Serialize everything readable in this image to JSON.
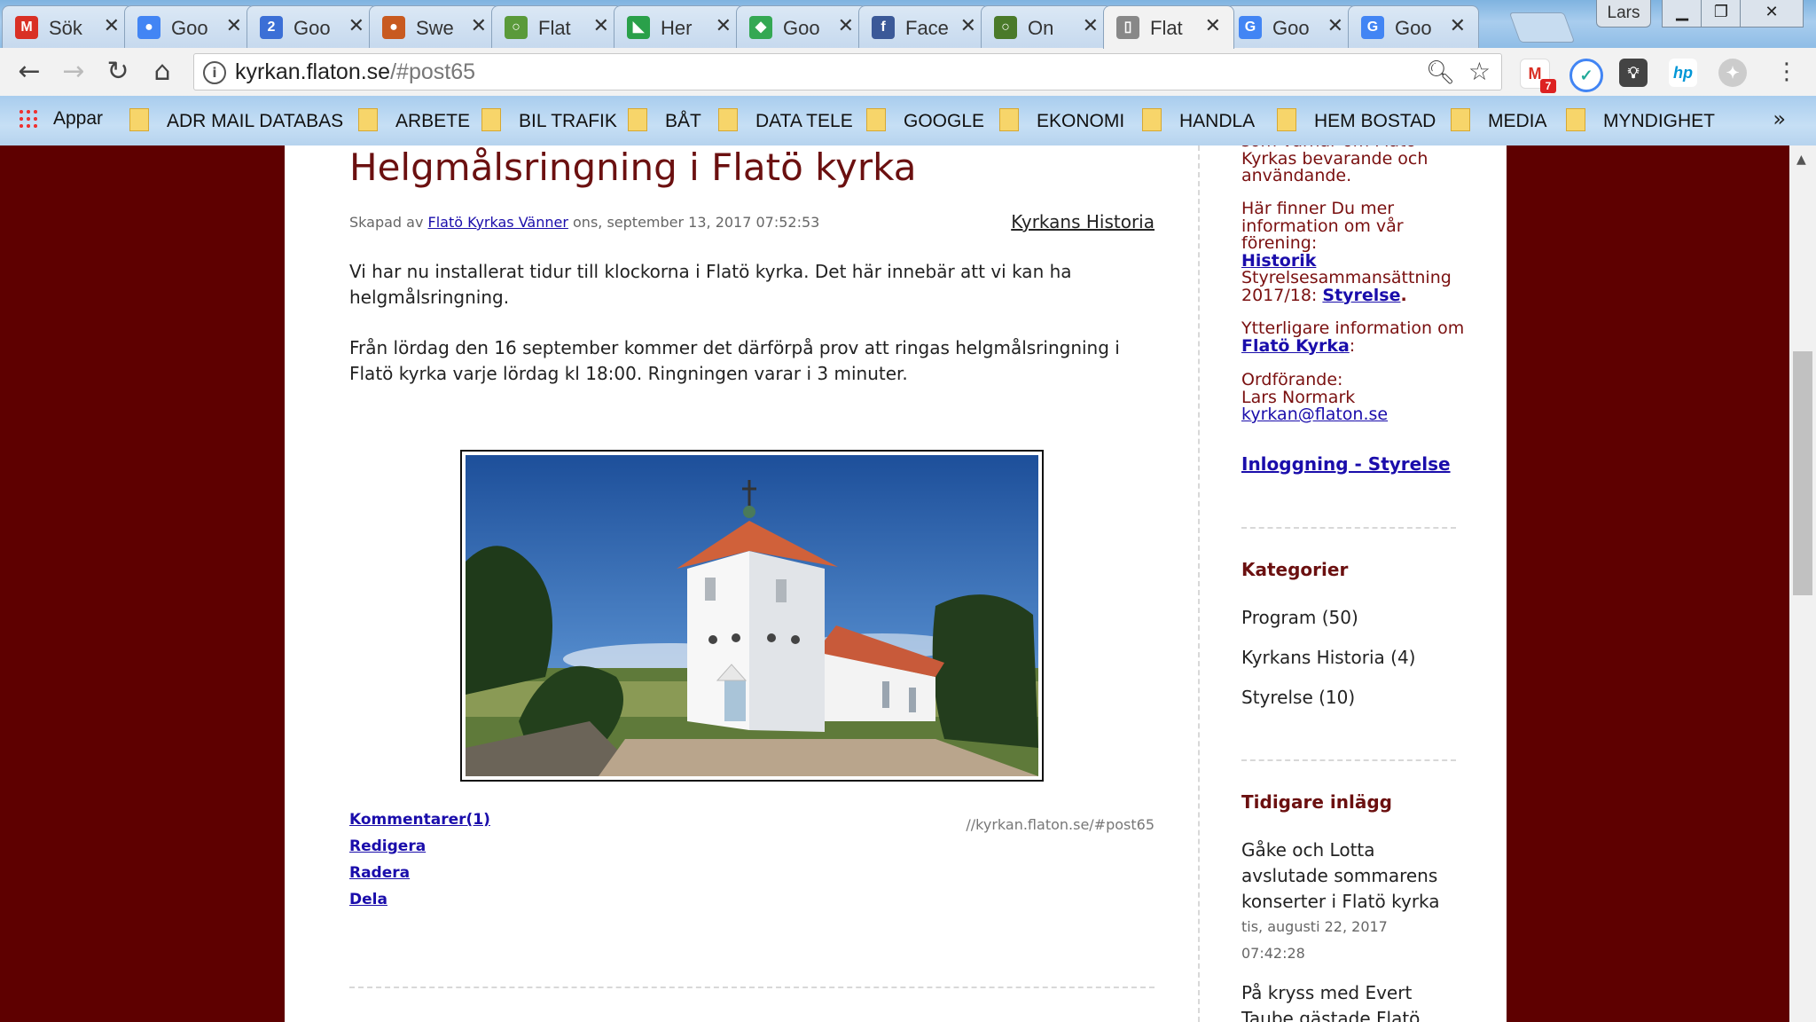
{
  "browser": {
    "tabs": [
      {
        "title": "Sök",
        "icon": "gmail-icon",
        "color": "#d93025",
        "glyph": "M"
      },
      {
        "title": "Goo",
        "icon": "google-contacts-icon",
        "color": "#4285f4",
        "glyph": "●"
      },
      {
        "title": "Goo",
        "icon": "google-calendar-icon",
        "color": "#3b6fd6",
        "glyph": "2"
      },
      {
        "title": "Swe",
        "icon": "swe-icon",
        "color": "#c85a20",
        "glyph": "●"
      },
      {
        "title": "Flat",
        "icon": "flaton-ring-icon",
        "color": "#5a9a3a",
        "glyph": "○"
      },
      {
        "title": "Her",
        "icon": "here-icon",
        "color": "#2aa04a",
        "glyph": "◣"
      },
      {
        "title": "Goo",
        "icon": "google-maps-icon",
        "color": "#34a853",
        "glyph": "◆"
      },
      {
        "title": "Face",
        "icon": "facebook-icon",
        "color": "#3b5998",
        "glyph": "f"
      },
      {
        "title": "On",
        "icon": "on-ring-icon",
        "color": "#4a7a2a",
        "glyph": "○"
      },
      {
        "title": "Flat",
        "icon": "page-icon",
        "color": "#888888",
        "glyph": "▯"
      },
      {
        "title": "Goo",
        "icon": "google-icon",
        "color": "#4285f4",
        "glyph": "G"
      },
      {
        "title": "Goo",
        "icon": "google-icon",
        "color": "#4285f4",
        "glyph": "G"
      }
    ],
    "user": "Lars",
    "url_host": "kyrkan.flaton.se",
    "url_path": "/#post65",
    "bookmarks": [
      {
        "label": "Appar",
        "type": "apps"
      },
      {
        "label": "ADR MAIL DATABAS",
        "type": "folder"
      },
      {
        "label": "ARBETE",
        "type": "folder"
      },
      {
        "label": "BIL TRAFIK",
        "type": "folder"
      },
      {
        "label": "BÅT",
        "type": "folder"
      },
      {
        "label": "DATA TELE",
        "type": "folder"
      },
      {
        "label": "GOOGLE",
        "type": "folder"
      },
      {
        "label": "EKONOMI",
        "type": "folder"
      },
      {
        "label": "HANDLA",
        "type": "folder"
      },
      {
        "label": "HEM BOSTAD",
        "type": "folder"
      },
      {
        "label": "MEDIA",
        "type": "folder"
      },
      {
        "label": "MYNDIGHET",
        "type": "folder"
      }
    ],
    "gmail_badge": "7"
  },
  "post": {
    "title": "Helgmålsringning i Flatö kyrka",
    "meta_prefix": "Skapad av",
    "author": "Flatö Kyrkas Vänner",
    "date": "ons, september 13, 2017 07:52:53",
    "category": "Kyrkans Historia",
    "paragraph1": "Vi har nu installerat tidur till klockorna i Flatö kyrka. Det här innebär att vi kan ha helgmålsringning.",
    "paragraph2": "Från lördag den 16 september kommer det därförpå prov att ringas helgmålsringning i Flatö kyrka varje lördag kl 18:00. Ringningen varar i 3 minuter.",
    "links": [
      "Kommentarer(1)",
      "Redigera",
      "Radera",
      "Dela"
    ],
    "permalink": "//kyrkan.flaton.se/#post65"
  },
  "sidebar": {
    "intro_cut": "som värnar om Flatö Kyrkas bevarande och användande.",
    "info_text": "Här finner Du mer information om vår förening:",
    "historik": "Historik",
    "styrelse_text": "Styrelsesammansättning 2017/18:",
    "styrelse_link": "Styrelse",
    "more_text": "Ytterligare information om",
    "kyrka_link": "Flatö Kyrka",
    "chair_label": "Ordförande:",
    "chair_name": "Lars Normark",
    "email": "kyrkan@flaton.se",
    "login": "Inloggning - Styrelse",
    "categories_heading": "Kategorier",
    "categories": [
      "Program (50)",
      "Kyrkans Historia (4)",
      "Styrelse (10)"
    ],
    "previous_heading": "Tidigare inlägg",
    "prev1_title": "Gåke och Lotta avslutade sommarens konserter i Flatö kyrka",
    "prev1_date": "tis, augusti 22, 2017 07:42:28",
    "prev2_title": "På kryss med Evert Taube gästade Flatö"
  }
}
